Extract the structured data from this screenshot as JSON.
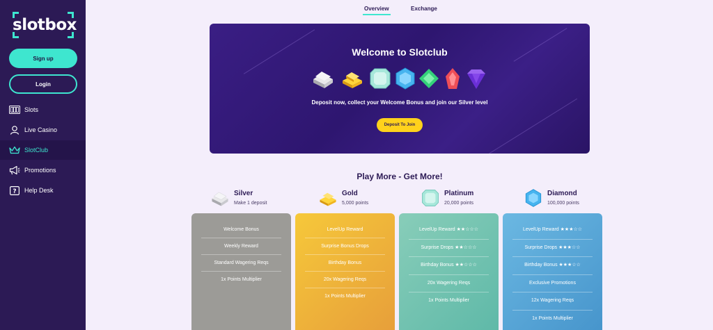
{
  "sidebar": {
    "logo": "slotbox",
    "signup_label": "Sign up",
    "login_label": "Login",
    "items": [
      {
        "label": "Slots",
        "icon": "slot-machine-icon"
      },
      {
        "label": "Live Casino",
        "icon": "dealer-icon"
      },
      {
        "label": "SlotClub",
        "icon": "crown-icon",
        "active": true
      },
      {
        "label": "Promotions",
        "icon": "megaphone-icon"
      },
      {
        "label": "Help Desk",
        "icon": "help-icon"
      }
    ]
  },
  "tabs": {
    "overview": "Overview",
    "exchange": "Exchange"
  },
  "hero": {
    "title": "Welcome to Slotclub",
    "subtitle": "Deposit now, collect your Welcome Bonus and join our Silver level",
    "cta_label": "Deposit To Join",
    "gems": [
      "silver-bar-icon",
      "gold-bar-icon",
      "platinum-gem-icon",
      "diamond-gem-icon",
      "emerald-gem-icon",
      "ruby-gem-icon",
      "amethyst-gem-icon"
    ]
  },
  "section_title": "Play More - Get More!",
  "tiers": [
    {
      "name": "Silver",
      "points": "Make 1 deposit",
      "perks": [
        "Welcome Bonus",
        "Weekly Reward",
        "Standard Wagering Reqs",
        "1x Points Multiplier"
      ]
    },
    {
      "name": "Gold",
      "points": "5,000 points",
      "perks": [
        "LevelUp Reward",
        "Surprise Bonus Drops",
        "Birthday Bonus",
        "20x Wagering Reqs",
        "1x Points Multiplier"
      ]
    },
    {
      "name": "Platinum",
      "points": "20,000 points",
      "perks": [
        "LevelUp Reward ★★☆☆☆",
        "Surprise Drops ★★☆☆☆",
        "Birthday Bonus ★★☆☆☆",
        "20x Wagering Reqs",
        "1x Points Multiplier"
      ]
    },
    {
      "name": "Diamond",
      "points": "100,000 points",
      "perks": [
        "LevelUp Reward ★★★☆☆",
        "Surprise Drops ★★★☆☆",
        "Birthday Bonus ★★★☆☆",
        "Exclusive Promotions",
        "12x Wagering Reqs",
        "1x Points Multiplier"
      ]
    }
  ],
  "colors": {
    "sidebar": "#2c1a55",
    "accent": "#3ee6cf",
    "cta": "#ffd21c",
    "background": "#f4eefb"
  }
}
